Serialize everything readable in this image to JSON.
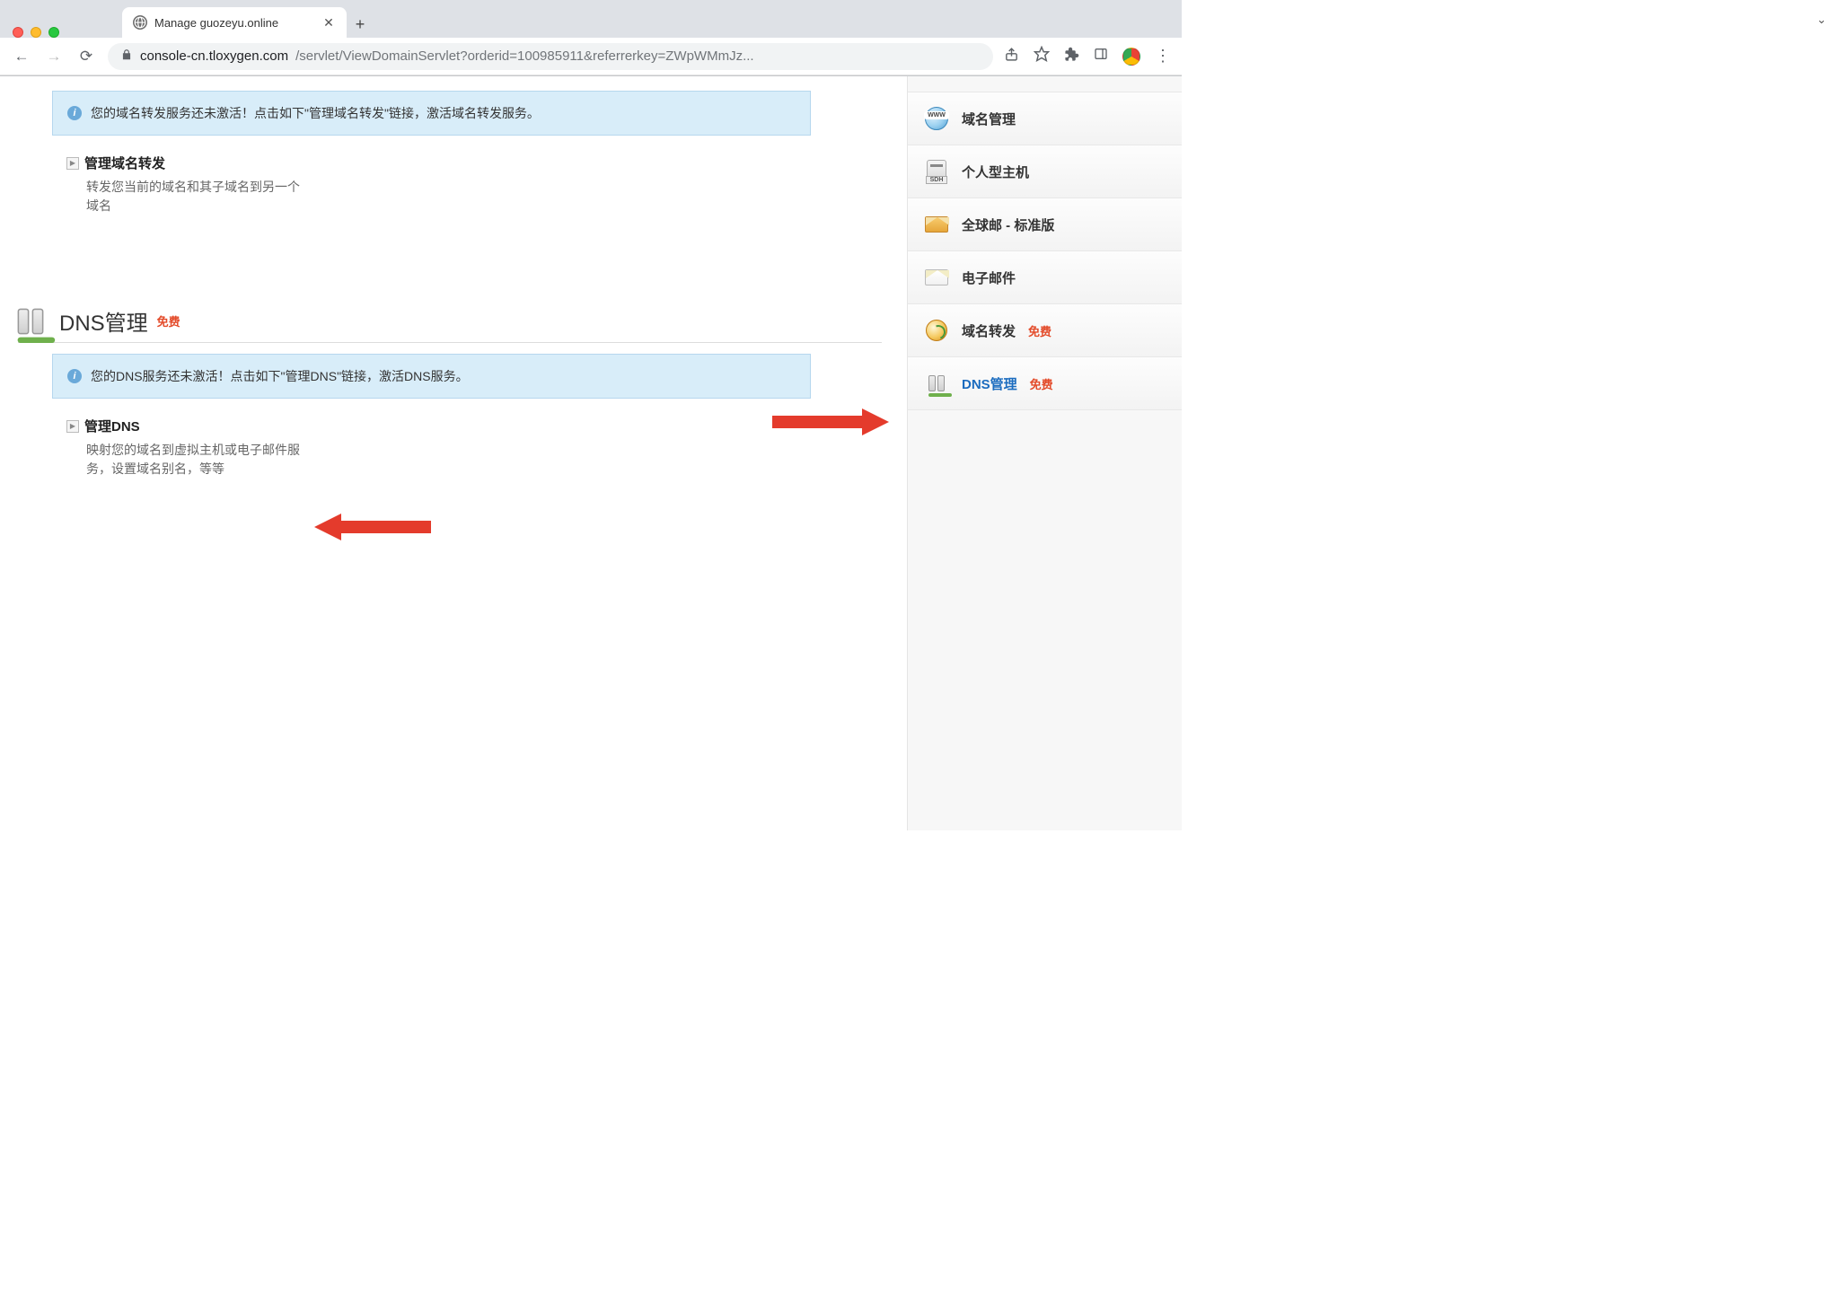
{
  "browser": {
    "tabTitle": "Manage guozeyu.online",
    "urlHost": "console-cn.tloxygen.com",
    "urlPath": "/servlet/ViewDomainServlet?orderid=100985911&referrerkey=ZWpWMmJz..."
  },
  "main": {
    "info1": "您的域名转发服务还未激活！点击如下\"管理域名转发\"链接，激活域名转发服务。",
    "action1Title": "管理域名转发",
    "action1Desc": "转发您当前的域名和其子域名到另一个域名",
    "sectionTitle": "DNS管理",
    "sectionBadge": "免费",
    "info2": "您的DNS服务还未激活！点击如下\"管理DNS\"链接，激活DNS服务。",
    "action2Title": "管理DNS",
    "action2Desc": "映射您的域名到虚拟主机或电子邮件服务，设置域名别名，等等"
  },
  "sidebar": {
    "items": [
      {
        "label": "域名管理",
        "badge": ""
      },
      {
        "label": "个人型主机",
        "badge": ""
      },
      {
        "label": "全球邮 - 标准版",
        "badge": ""
      },
      {
        "label": "电子邮件",
        "badge": ""
      },
      {
        "label": "域名转发",
        "badge": "免费"
      },
      {
        "label": "DNS管理",
        "badge": "免费"
      }
    ]
  }
}
